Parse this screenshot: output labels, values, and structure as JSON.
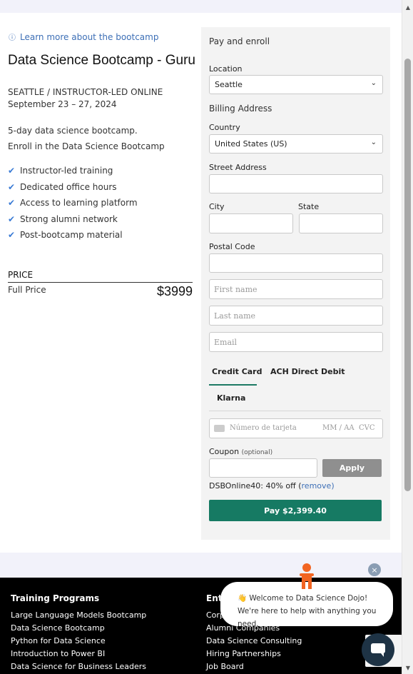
{
  "page": {
    "learn_more": "Learn more about the bootcamp",
    "title": "Data Science Bootcamp - Guru",
    "location_mode": "SEATTLE / INSTRUCTOR-LED ONLINE",
    "dates": "September 23 – 27, 2024",
    "description_1": "5-day data science bootcamp.",
    "description_2": "Enroll in the Data Science Bootcamp",
    "features": [
      "Instructor-led training",
      "Dedicated office hours",
      "Access to learning platform",
      "Strong alumni network",
      "Post-bootcamp material"
    ],
    "price_label": "PRICE",
    "full_price_label": "Full Price",
    "price_value": "$3999"
  },
  "form": {
    "title": "Pay and enroll",
    "location_label": "Location",
    "location_value": "Seattle",
    "billing_title": "Billing Address",
    "country_label": "Country",
    "country_value": "United States (US)",
    "street_label": "Street Address",
    "city_label": "City",
    "state_label": "State",
    "postal_label": "Postal Code",
    "first_name_ph": "First name",
    "last_name_ph": "Last name",
    "email_ph": "Email",
    "tabs": [
      "Credit Card",
      "ACH Direct Debit",
      "Klarna"
    ],
    "card_number_ph": "Número de tarjeta",
    "card_expiry_ph": "MM / AA",
    "card_cvc_ph": "CVC",
    "coupon_label": "Coupon",
    "coupon_optional": "(optional)",
    "apply_label": "Apply",
    "coupon_applied": "DSBOnline40: 40% off (",
    "coupon_remove": "remove",
    "coupon_close_paren": ")",
    "pay_label": "Pay $2,399.40"
  },
  "footer": {
    "training_heading": "Training Programs",
    "training_links": [
      "Large Language Models Bootcamp",
      "Data Science Bootcamp",
      "Python for Data Science",
      "Introduction to Power BI",
      "Data Science for Business Leaders"
    ],
    "enterprise_heading_partial": "Ent",
    "enterprise_links": [
      "Corp",
      "Alumni Companies",
      "Data Science Consulting",
      "Hiring Partnerships",
      "Job Board"
    ]
  },
  "chat": {
    "message": "👋 Welcome to Data Science Dojo! We're here to help with anything you need.",
    "close": "×"
  },
  "colors": {
    "accent_green": "#167a63",
    "link_blue": "#3d6fb6",
    "check_blue": "#3a7bd5"
  }
}
